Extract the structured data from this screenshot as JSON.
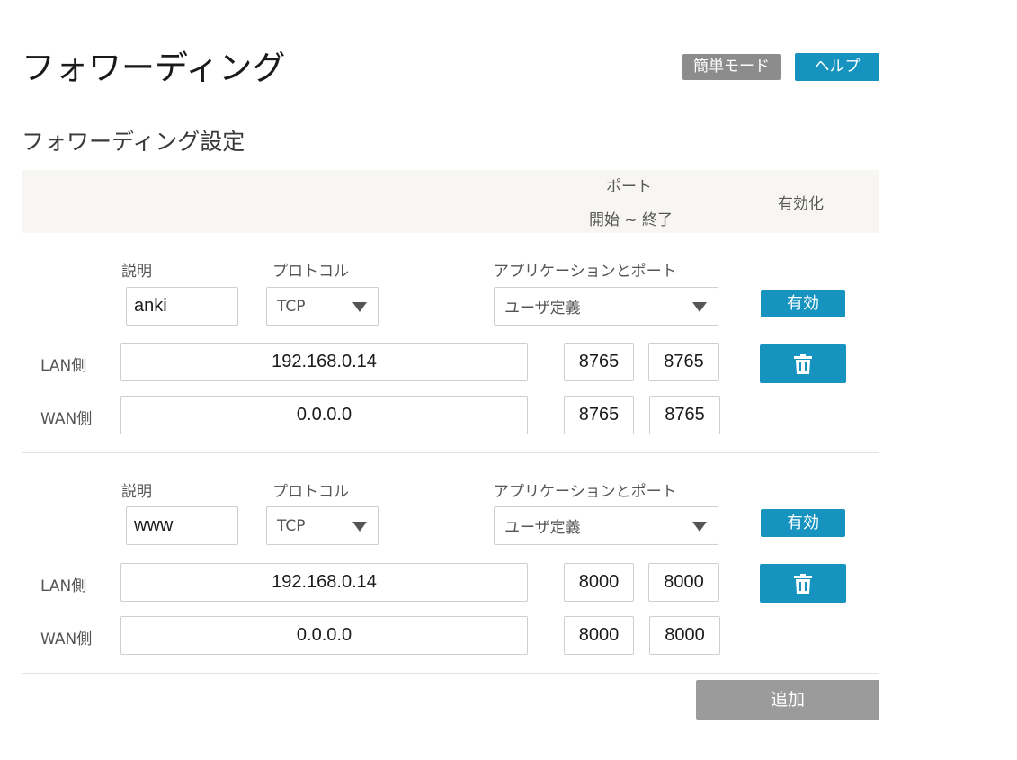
{
  "header": {
    "title": "フォワーディング",
    "simple_mode_label": "簡単モード",
    "help_label": "ヘルプ"
  },
  "section": {
    "title": "フォワーディング設定"
  },
  "table_header": {
    "port_label": "ポート",
    "port_range_label": "開始 ~ 終了",
    "enable_label": "有効化"
  },
  "icons": {
    "delete": "trash-icon",
    "dropdown": "chevron-down-icon"
  },
  "colors": {
    "accent": "#1793bf",
    "neutral_button": "#8c8c8c",
    "add_button": "#9b9b9b"
  },
  "rules": [
    {
      "description_label": "説明",
      "protocol_label": "プロトコル",
      "app_port_label": "アプリケーションとポート",
      "description": "anki",
      "protocol": "TCP",
      "app_port": "ユーザ定義",
      "enabled_label": "有効",
      "lan_label": "LAN側",
      "lan_ip": "192.168.0.14",
      "lan_port_start": "8765",
      "lan_port_end": "8765",
      "wan_label": "WAN側",
      "wan_ip": "0.0.0.0",
      "wan_port_start": "8765",
      "wan_port_end": "8765"
    },
    {
      "description_label": "説明",
      "protocol_label": "プロトコル",
      "app_port_label": "アプリケーションとポート",
      "description": "www",
      "protocol": "TCP",
      "app_port": "ユーザ定義",
      "enabled_label": "有効",
      "lan_label": "LAN側",
      "lan_ip": "192.168.0.14",
      "lan_port_start": "8000",
      "lan_port_end": "8000",
      "wan_label": "WAN側",
      "wan_ip": "0.0.0.0",
      "wan_port_start": "8000",
      "wan_port_end": "8000"
    }
  ],
  "footer": {
    "add_label": "追加"
  }
}
